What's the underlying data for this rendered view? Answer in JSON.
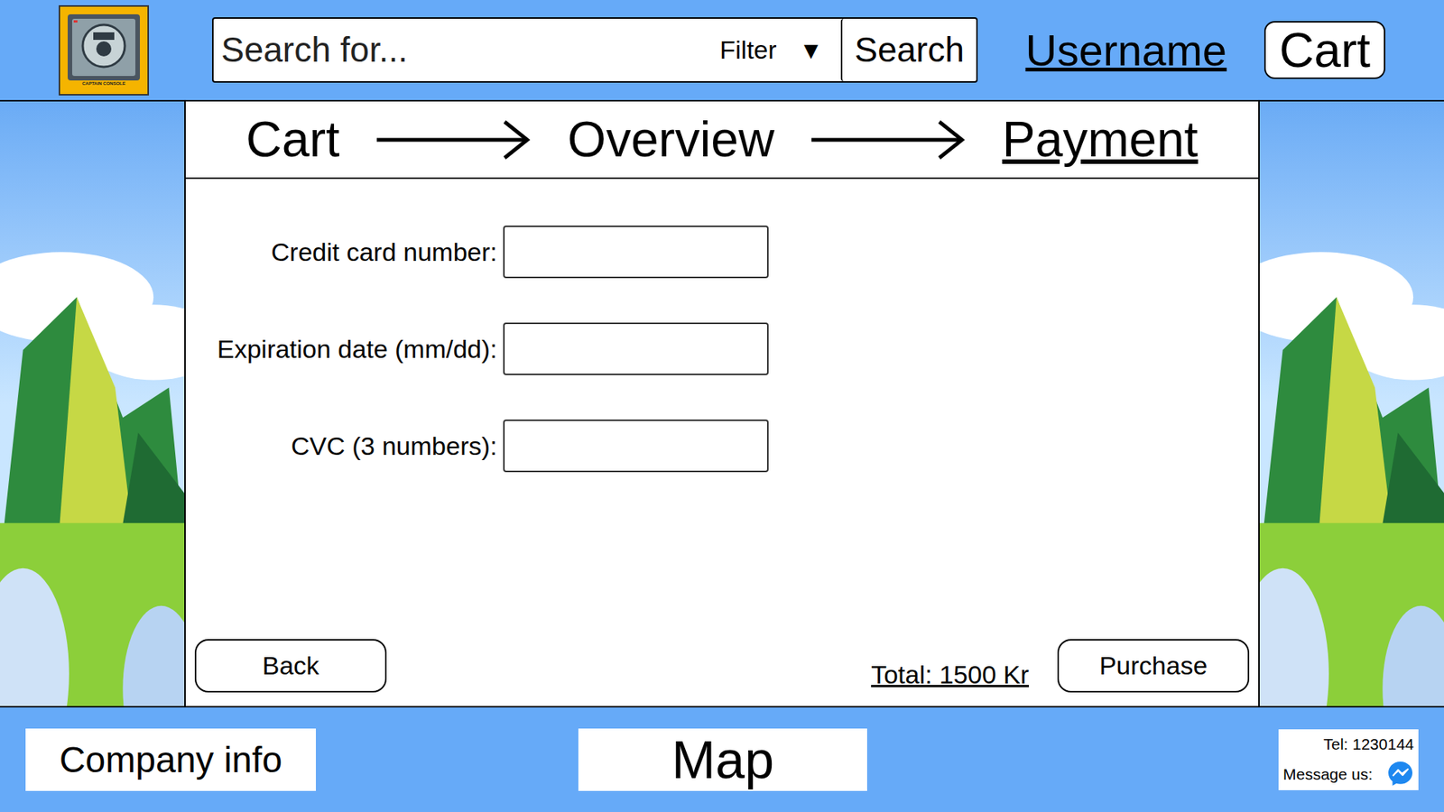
{
  "header": {
    "logo": {
      "text": "CAPTAIN CONSOLE"
    },
    "search": {
      "placeholder": "Search for...",
      "filter": "Filter",
      "filter_arrow": "▼",
      "button": "Search"
    },
    "username": "Username",
    "cart": "Cart"
  },
  "steps": [
    {
      "label": "Cart",
      "selected": false
    },
    {
      "label": "Overview",
      "selected": false
    },
    {
      "label": "Payment",
      "selected": true
    }
  ],
  "form": {
    "fields": [
      {
        "label": "Credit card number:",
        "value": ""
      },
      {
        "label": "Expiration date (mm/dd):",
        "value": ""
      },
      {
        "label": "CVC (3 numbers):",
        "value": ""
      }
    ]
  },
  "actions": {
    "back": "Back",
    "total": "Total: 1500 Kr",
    "purchase": "Purchase"
  },
  "footer": {
    "company_info": "Company info",
    "map": "Map",
    "tel": "Tel: 1230144",
    "message": "Message us:"
  }
}
